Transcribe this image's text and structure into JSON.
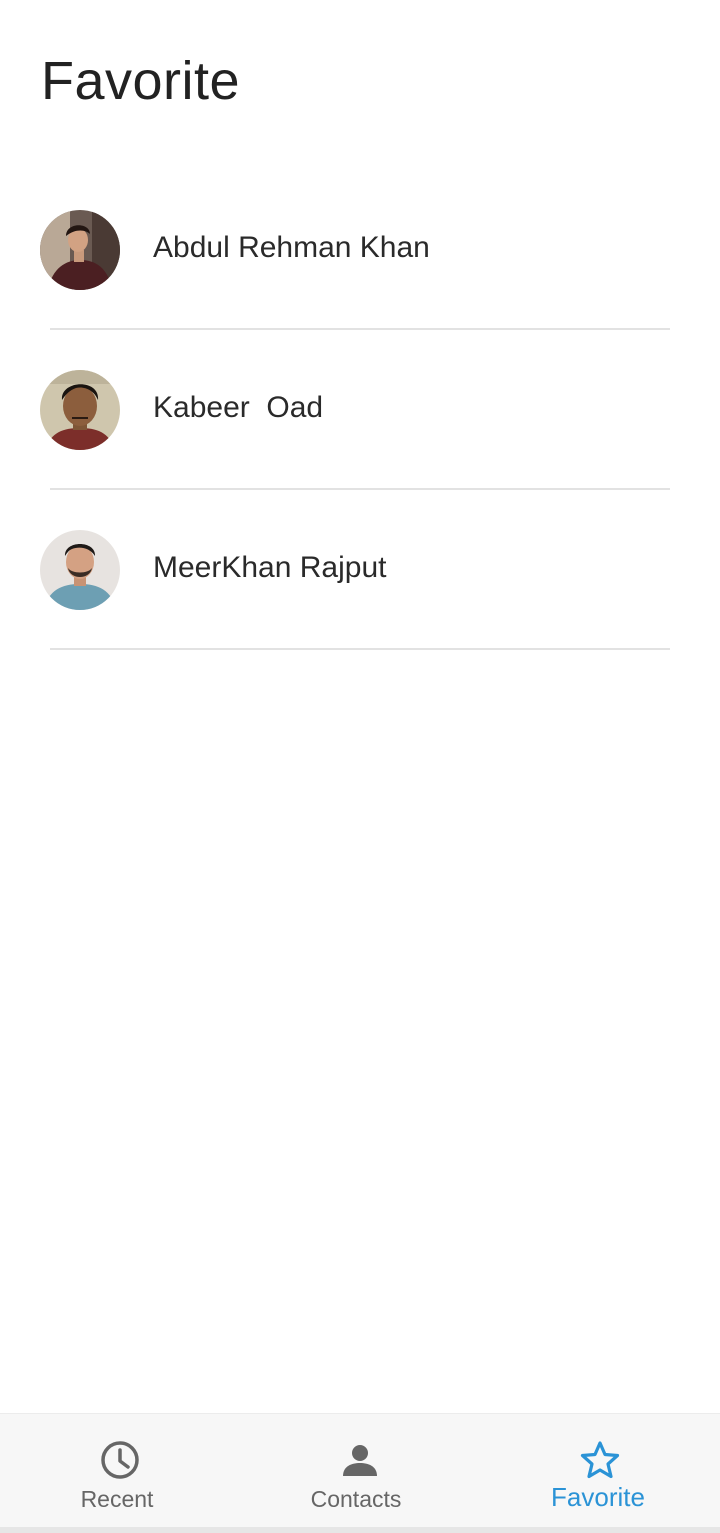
{
  "header": {
    "title": "Favorite"
  },
  "contacts": [
    {
      "name": "Abdul Rehman Khan"
    },
    {
      "name": "Kabeer  Oad"
    },
    {
      "name": "MeerKhan Rajput"
    }
  ],
  "nav": {
    "items": [
      {
        "label": "Recent",
        "icon": "clock-icon"
      },
      {
        "label": "Contacts",
        "icon": "person-icon"
      },
      {
        "label": "Favorite",
        "icon": "star-outline-icon"
      }
    ],
    "active_index": 2,
    "active_color": "#2b93d6",
    "inactive_color": "#666666"
  }
}
